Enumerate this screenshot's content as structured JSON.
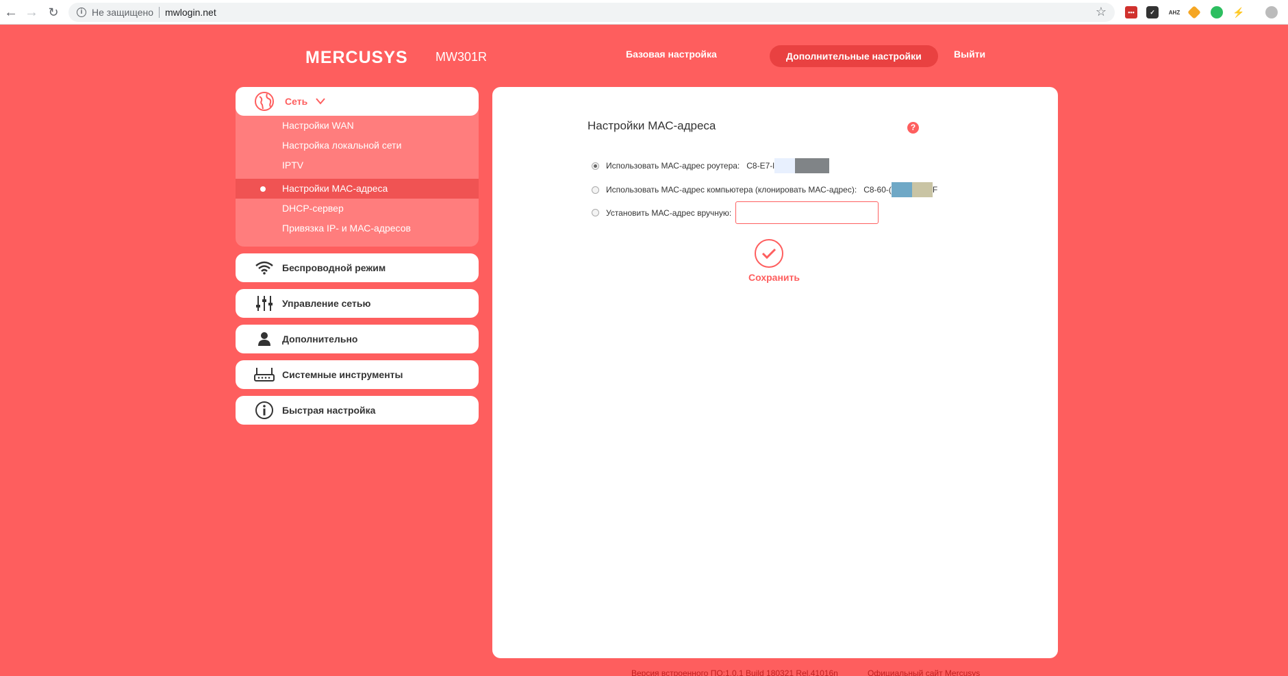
{
  "browser": {
    "security_label": "Не защищено",
    "url": "mwlogin.net"
  },
  "header": {
    "brand": "MERCUSYS",
    "model": "MW301R",
    "nav": {
      "basic": "Базовая настройка",
      "advanced": "Дополнительные настройки",
      "logout": "Выйти"
    }
  },
  "sidebar": {
    "network_label": "Сеть",
    "network_items": [
      "Настройки WAN",
      "Настройка локальной сети",
      "IPTV",
      "Настройки МАС-адреса",
      "DHCP-сервер",
      "Привязка IP- и МАС-адресов"
    ],
    "active_index": 3,
    "menu": [
      {
        "label": "Беспроводной режим",
        "icon": "wifi-icon"
      },
      {
        "label": "Управление сетью",
        "icon": "sliders-icon"
      },
      {
        "label": "Дополнительно",
        "icon": "user-icon"
      },
      {
        "label": "Системные инструменты",
        "icon": "router-icon"
      },
      {
        "label": "Быстрая настройка",
        "icon": "info-icon"
      }
    ]
  },
  "content": {
    "title": "Настройки МАС-адреса",
    "help": "?",
    "options": {
      "router_label": "Использовать МАС-адрес роутера:",
      "router_mac": "C8-E7-l",
      "computer_label": "Использовать МАС-адрес компьютера (клонировать МАС-адрес):",
      "computer_mac": "C8-60-(",
      "computer_mac_tail": "F",
      "manual_label": "Установить МАС-адрес вручную:",
      "manual_value": ""
    },
    "selected_option": "router",
    "save_label": "Сохранить"
  },
  "footer": {
    "firmware": "Версия встроенного ПО:1.0.1 Build 180321 Rel.41016n",
    "official_site": "Официальный сайт Mercusys"
  },
  "colors": {
    "brand": "#fe5e5e",
    "sidebar_sub": "#ff7d7d",
    "active": "#e94141"
  }
}
